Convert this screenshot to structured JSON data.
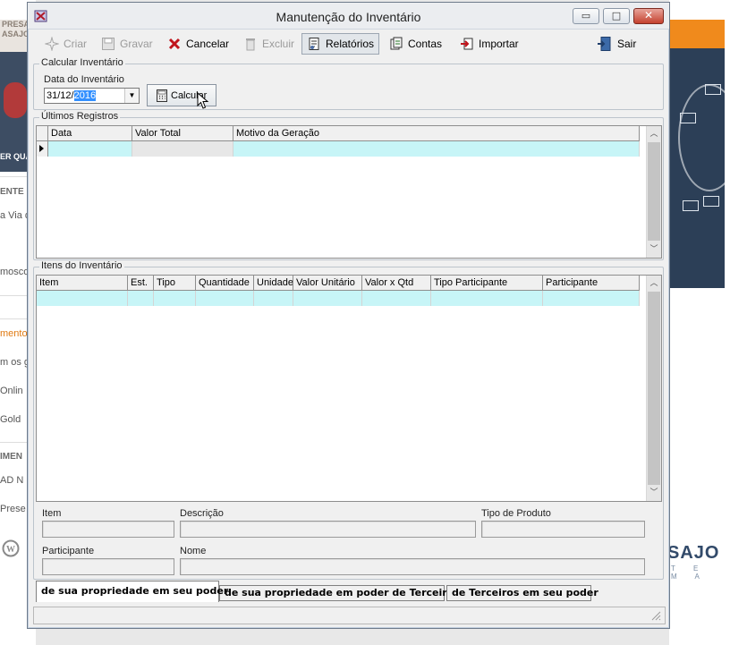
{
  "background": {
    "left_banner_lines": [
      "PRESA",
      "ASAJO"
    ],
    "left_banner_caption": "ER QUA",
    "left_items": [
      {
        "text": "ENTE",
        "style": "hdr"
      },
      {
        "text": "a Via d",
        "style": ""
      },
      {
        "text": "mosco",
        "style": ""
      },
      {
        "text": "mento",
        "style": "orange"
      },
      {
        "text": "m os g",
        "style": ""
      },
      {
        "text": "Onlin",
        "style": ""
      },
      {
        "text": "Gold",
        "style": ""
      },
      {
        "text": "IMEN",
        "style": "hdr"
      },
      {
        "text": "AD N",
        "style": ""
      },
      {
        "text": "Prese",
        "style": ""
      }
    ],
    "right_brand": "SAJO",
    "right_brand_sub": "T E M A"
  },
  "window": {
    "title": "Manutenção do Inventário",
    "controls": {
      "minimize": "▭",
      "maximize": "□",
      "close": "✕"
    }
  },
  "toolbar": {
    "criar": "Criar",
    "gravar": "Gravar",
    "cancelar": "Cancelar",
    "excluir": "Excluir",
    "relatorios": "Relatórios",
    "contas": "Contas",
    "importar": "Importar",
    "sair": "Sair"
  },
  "calcular": {
    "legend": "Calcular Inventário",
    "date_label": "Data do Inventário",
    "date_prefix": "31/12/",
    "date_selected": "2016",
    "button": "Calcular"
  },
  "registros": {
    "legend": "Últimos Registros",
    "columns": [
      "Data",
      "Valor Total",
      "Motivo da Geração"
    ]
  },
  "itens": {
    "legend": "Itens do Inventário",
    "columns": [
      "Item",
      "Est.",
      "Tipo",
      "Quantidade",
      "Unidade",
      "Valor Unitário",
      "Valor x Qtd",
      "Tipo Participante",
      "Participante"
    ]
  },
  "details": {
    "item": "Item",
    "descricao": "Descrição",
    "tipo_produto": "Tipo de Produto",
    "participante": "Participante",
    "nome": "Nome"
  },
  "tabs": [
    {
      "label": "de sua propriedade em seu poder",
      "active": true
    },
    {
      "label": "de sua propriedade em poder de Terceiros",
      "active": false
    },
    {
      "label": "de Terceiros em seu poder",
      "active": false
    }
  ]
}
